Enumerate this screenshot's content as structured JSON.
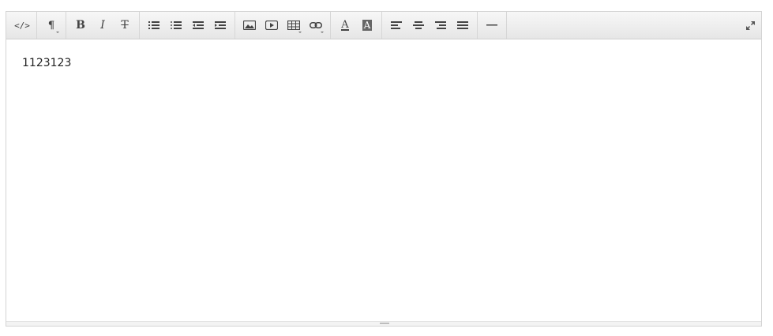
{
  "toolbar": {
    "groups": [
      [
        "html-view"
      ],
      [
        "paragraph-format"
      ],
      [
        "bold",
        "italic",
        "strikethrough"
      ],
      [
        "bullet-list",
        "numbered-list",
        "outdent",
        "indent"
      ],
      [
        "insert-image",
        "insert-video",
        "insert-table",
        "insert-link"
      ],
      [
        "text-color",
        "background-color"
      ],
      [
        "align-left",
        "align-center",
        "align-right",
        "align-justify"
      ],
      [
        "horizontal-rule"
      ]
    ],
    "labels": {
      "html": "</>",
      "paragraph": "¶",
      "bold": "B",
      "italic": "I",
      "strike": "T",
      "color": "A",
      "bgcolor": "A"
    }
  },
  "editor": {
    "content": "1123123"
  }
}
